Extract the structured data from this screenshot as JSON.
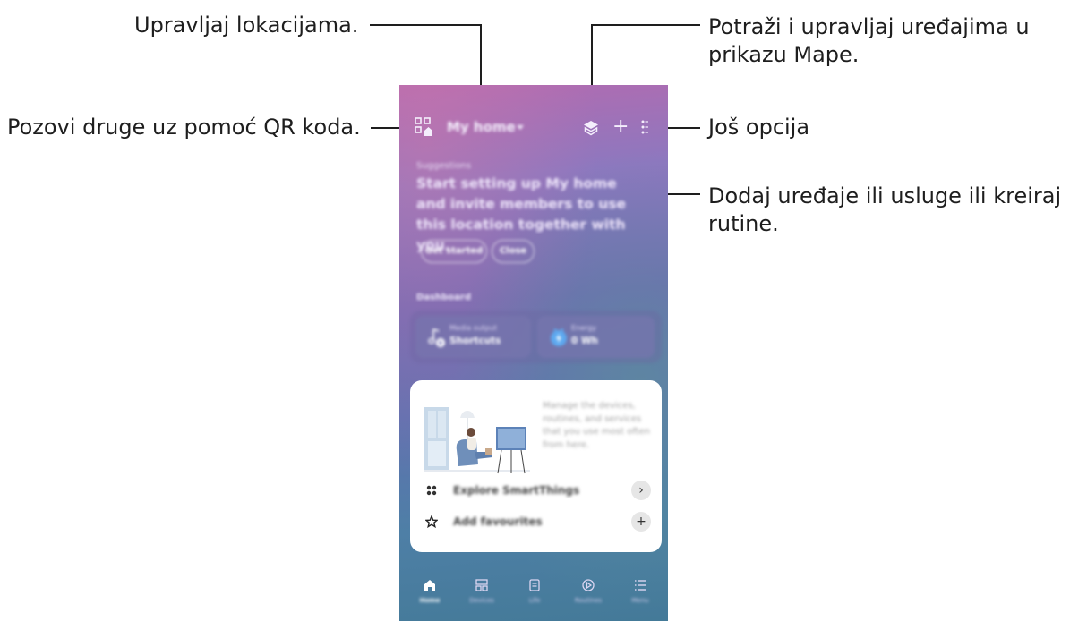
{
  "callouts": {
    "manage_locations": "Upravljaj lokacijama.",
    "invite_qr": "Pozovi druge uz pomoć QR koda.",
    "map_line1": "Potraži i upravljaj uređajima u",
    "map_line2": "prikazu Mape.",
    "more_options": "Još opcija",
    "add_line1": "Dodaj uređaje ili usluge ili kreiraj",
    "add_line2": "rutine."
  },
  "app": {
    "location_name": "My home",
    "suggestions_label": "Suggestions",
    "suggestion_text": "Start setting up My home and invite members to use this location together with you.",
    "get_started": "Get started",
    "close": "Close",
    "dashboard_label": "Dashboard",
    "tiles": [
      {
        "sub": "Media output",
        "main": "Shortcuts",
        "icon": "music-note-icon"
      },
      {
        "sub": "Energy",
        "main": "0 Wh",
        "icon": "energy-plug-icon"
      }
    ],
    "card_text": "Manage the devices, routines, and services that you use most often from here.",
    "rows": [
      {
        "label": "Explore SmartThings",
        "button": "›",
        "icon": "smartthings-icon"
      },
      {
        "label": "Add favourites",
        "button": "+",
        "icon": "star-icon"
      }
    ],
    "nav": [
      {
        "label": "Home",
        "icon": "home-icon"
      },
      {
        "label": "Devices",
        "icon": "devices-icon"
      },
      {
        "label": "Life",
        "icon": "life-icon"
      },
      {
        "label": "Routines",
        "icon": "routines-icon"
      },
      {
        "label": "Menu",
        "icon": "menu-icon"
      }
    ]
  },
  "colors": {
    "callout_text": "#1e1e1e",
    "phone_gradient_top": "#b26bb0",
    "phone_gradient_bottom": "#447a98",
    "card_bg": "#ffffff"
  }
}
